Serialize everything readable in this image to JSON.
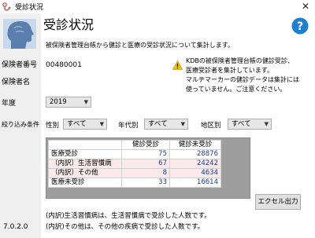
{
  "window": {
    "title": "受診状況",
    "close": "✕"
  },
  "header": {
    "title": "受診状況",
    "description": "被保険者管理台帳から健診と医療の受診状況について集計します。"
  },
  "sidebar": {
    "insurer_number_label": "保険者番号",
    "insurer_name_label": "保険者名",
    "year_label": "年度",
    "filter_label": "絞り込み条件",
    "version": "7.0.2.0"
  },
  "insurer": {
    "number": "00480001"
  },
  "notice": {
    "lines": [
      "KDBの被保険者管理台帳の健診受診、",
      "医療受診者を集計しています。",
      "マルチマーカーの健診データは集計には",
      "使っていません。ご注意ください。"
    ]
  },
  "year": {
    "value": "2019"
  },
  "filters": {
    "sex": {
      "label": "性別",
      "value": "すべて"
    },
    "age": {
      "label": "年代別",
      "value": "すべて"
    },
    "region": {
      "label": "地区別",
      "value": "すべて"
    }
  },
  "table": {
    "headers": [
      "",
      "健診受診",
      "健診未受診"
    ],
    "rows": [
      {
        "label": "医療受診",
        "v1": "75",
        "v2": "28876"
      },
      {
        "label": "（内訳）生活習慣病",
        "v1": "67",
        "v2": "24242"
      },
      {
        "label": "（内訳）その他",
        "v1": "8",
        "v2": "4634"
      },
      {
        "label": "医療未受診",
        "v1": "33",
        "v2": "16614"
      }
    ]
  },
  "buttons": {
    "excel": "エクセル出力"
  },
  "footnotes": [
    "(内訳)生活習慣病は、生活習慣病で受診した人数です。",
    "(内訳)その他は、その他の疾病で受診した人数です。"
  ],
  "icons": {
    "app": "stethoscope-icon",
    "head": "head-profile-icon",
    "help": "help-icon",
    "warning": "warning-icon",
    "dropdown": "chevron-down-icon"
  },
  "colors": {
    "help": "#1f7fd1",
    "warning": "#f2c200",
    "number_text": "#1e3c8c",
    "row_highlight": "#fbe9ec"
  }
}
